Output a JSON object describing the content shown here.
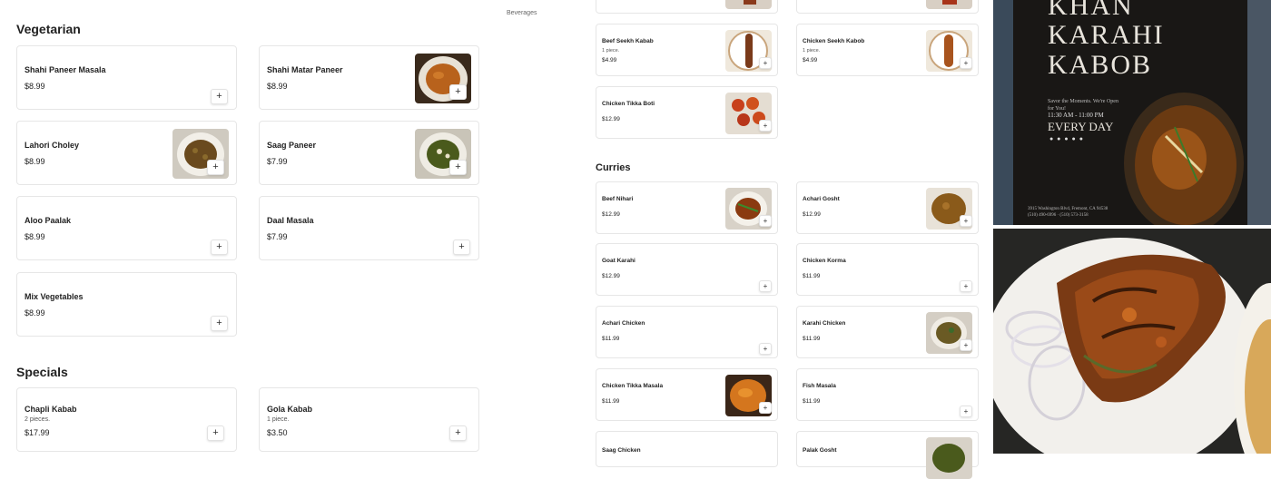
{
  "nav": {
    "beverages_label": "Beverages"
  },
  "left": {
    "vegetarian_title": "Vegetarian",
    "specials_title": "Specials",
    "vegetarian_items": [
      {
        "name": "Shahi Paneer Masala",
        "price": "$8.99"
      },
      {
        "name": "Shahi Matar Paneer",
        "price": "$8.99"
      },
      {
        "name": "Lahori Choley",
        "price": "$8.99"
      },
      {
        "name": "Saag Paneer",
        "price": "$7.99"
      },
      {
        "name": "Aloo Paalak",
        "price": "$8.99"
      },
      {
        "name": "Daal Masala",
        "price": "$7.99"
      },
      {
        "name": "Mix Vegetables",
        "price": "$8.99"
      }
    ],
    "specials_items": [
      {
        "name": "Chapli Kabab",
        "desc": "2 pieces.",
        "price": "$17.99"
      },
      {
        "name": "Gola Kabab",
        "desc": "1 piece.",
        "price": "$3.50"
      }
    ]
  },
  "right": {
    "curries_title": "Curries",
    "kabab_items": [
      {
        "name": "Beef Seekh Kabab",
        "desc": "1 piece.",
        "price": "$4.99"
      },
      {
        "name": "Chicken Seekh Kabob",
        "desc": "1 piece.",
        "price": "$4.99"
      },
      {
        "name": "Chicken Tikka Boti",
        "price": "$12.99"
      }
    ],
    "curry_items": [
      {
        "name": "Beef Nihari",
        "price": "$12.99"
      },
      {
        "name": "Achari Gosht",
        "price": "$12.99"
      },
      {
        "name": "Goat Karahi",
        "price": "$12.99"
      },
      {
        "name": "Chicken Korma",
        "price": "$11.99"
      },
      {
        "name": "Achari Chicken",
        "price": "$11.99"
      },
      {
        "name": "Karahi Chicken",
        "price": "$11.99"
      },
      {
        "name": "Chicken Tikka Masala",
        "price": "$11.99"
      },
      {
        "name": "Fish Masala",
        "price": "$11.99"
      },
      {
        "name": "Saag Chicken"
      },
      {
        "name": "Palak Gosht"
      }
    ]
  },
  "poster": {
    "title_line1": "KHAN",
    "title_line2": "KARAHI",
    "title_line3": "KABOB",
    "tagline": "Savor the Moments. We're Open for You!",
    "hours": "11:30 AM - 11:00 PM",
    "days": "EVERY DAY",
    "address": "3915 Washington Blvd, Fremont, CA 94538",
    "phone": "(510) 490-6996 · (510) 573-3158"
  },
  "add_symbol": "+"
}
